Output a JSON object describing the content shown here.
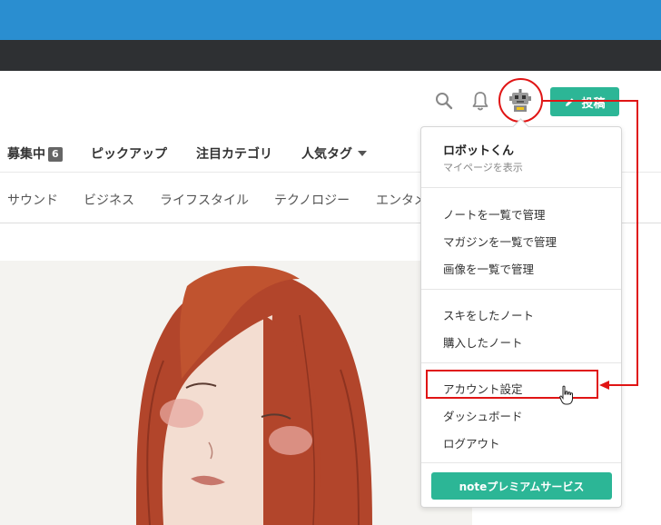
{
  "header": {
    "post_button_label": "投稿",
    "icons": [
      "search-icon",
      "bell-icon",
      "robot-avatar-icon",
      "pencil-icon"
    ]
  },
  "nav_primary": {
    "recruiting_label": "募集中",
    "recruiting_count": "6",
    "pickup_label": "ピックアップ",
    "category_label": "注目カテゴリ",
    "tags_label": "人気タグ"
  },
  "nav_categories": [
    "サウンド",
    "ビジネス",
    "ライフスタイル",
    "テクノロジー",
    "エンタメ"
  ],
  "dropdown": {
    "user_name": "ロボットくん",
    "user_sub": "マイページを表示",
    "manage_notes": "ノートを一覧で管理",
    "manage_magazines": "マガジンを一覧で管理",
    "manage_images": "画像を一覧で管理",
    "liked_notes": "スキをしたノート",
    "purchased_notes": "購入したノート",
    "account_settings": "アカウント設定",
    "dashboard": "ダッシュボード",
    "logout": "ログアウト",
    "premium_button": "noteプレミアムサービス"
  },
  "colors": {
    "brand_green": "#2cb696",
    "top_bar_blue": "#2a8ed0",
    "annotation_red": "#e01515"
  }
}
